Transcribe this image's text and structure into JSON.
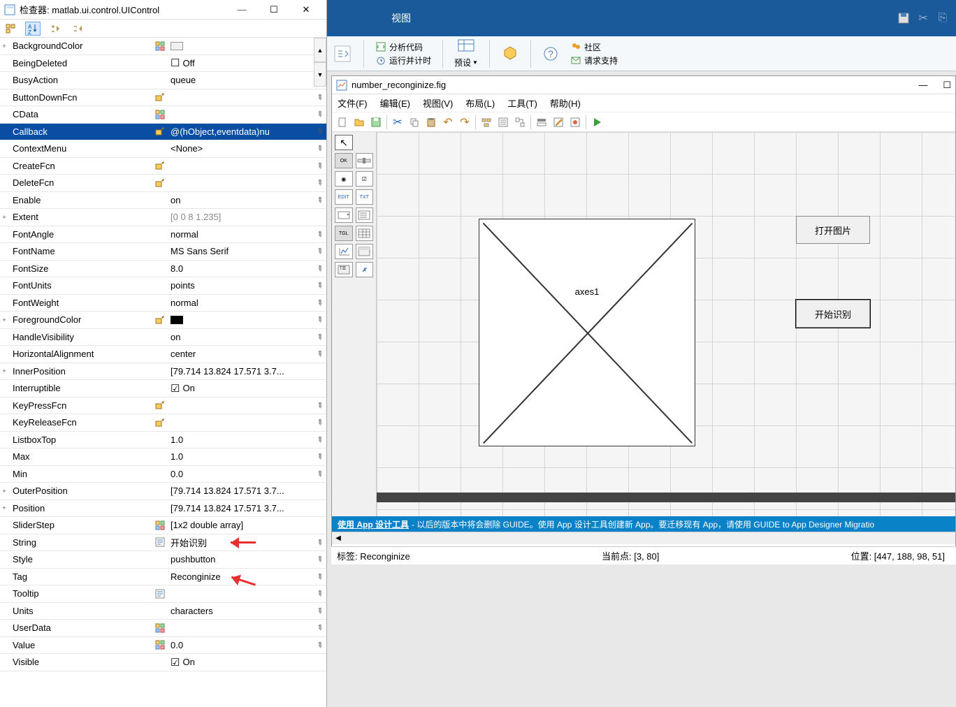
{
  "inspector": {
    "title": "检查器: matlab.ui.control.UIControl",
    "props": [
      {
        "name": "BackgroundColor",
        "icon": "grid",
        "val": "",
        "expand": "+",
        "swatch": "bg",
        "edit": true
      },
      {
        "name": "BeingDeleted",
        "val": "Off",
        "chk": false
      },
      {
        "name": "BusyAction",
        "val": "queue",
        "edit": true
      },
      {
        "name": "ButtonDownFcn",
        "icon": "paint",
        "val": "",
        "edit": true
      },
      {
        "name": "CData",
        "icon": "grid",
        "val": "",
        "edit": true
      },
      {
        "name": "Callback",
        "icon": "paint",
        "val": "@(hObject,eventdata)nu",
        "edit": true,
        "selected": true
      },
      {
        "name": "ContextMenu",
        "val": "<None>",
        "edit": true
      },
      {
        "name": "CreateFcn",
        "icon": "paint",
        "val": "",
        "edit": true
      },
      {
        "name": "DeleteFcn",
        "icon": "paint",
        "val": "",
        "edit": true
      },
      {
        "name": "Enable",
        "val": "on",
        "edit": true
      },
      {
        "name": "Extent",
        "val": "[0 0 8 1.235]",
        "expand": "+",
        "gray": true
      },
      {
        "name": "FontAngle",
        "val": "normal",
        "edit": true
      },
      {
        "name": "FontName",
        "val": "MS Sans Serif",
        "edit": true
      },
      {
        "name": "FontSize",
        "val": "8.0",
        "edit": true
      },
      {
        "name": "FontUnits",
        "val": "points",
        "edit": true
      },
      {
        "name": "FontWeight",
        "val": "normal",
        "edit": true
      },
      {
        "name": "ForegroundColor",
        "icon": "paintc",
        "val": "",
        "expand": "+",
        "swatch": "fg",
        "edit": true
      },
      {
        "name": "HandleVisibility",
        "val": "on",
        "edit": true
      },
      {
        "name": "HorizontalAlignment",
        "val": "center",
        "edit": true
      },
      {
        "name": "InnerPosition",
        "val": "[79.714 13.824 17.571 3.7...",
        "expand": "+"
      },
      {
        "name": "Interruptible",
        "val": "On",
        "chk": true
      },
      {
        "name": "KeyPressFcn",
        "icon": "paint",
        "val": "",
        "edit": true
      },
      {
        "name": "KeyReleaseFcn",
        "icon": "paint",
        "val": "",
        "edit": true
      },
      {
        "name": "ListboxTop",
        "val": "1.0",
        "edit": true
      },
      {
        "name": "Max",
        "val": "1.0",
        "edit": true
      },
      {
        "name": "Min",
        "val": "0.0",
        "edit": true
      },
      {
        "name": "OuterPosition",
        "val": "[79.714 13.824 17.571 3.7...",
        "expand": "+"
      },
      {
        "name": "Position",
        "val": "[79.714 13.824 17.571 3.7...",
        "expand": "+"
      },
      {
        "name": "SliderStep",
        "icon": "grid",
        "val": "[1x2  double array]"
      },
      {
        "name": "String",
        "icon": "lines",
        "val": "开始识别",
        "edit": true,
        "arrow": true
      },
      {
        "name": "Style",
        "val": "pushbutton",
        "edit": true
      },
      {
        "name": "Tag",
        "val": "Reconginize",
        "edit": true,
        "arrow": true
      },
      {
        "name": "Tooltip",
        "icon": "lines",
        "val": "",
        "edit": true
      },
      {
        "name": "Units",
        "val": "characters",
        "edit": true
      },
      {
        "name": "UserData",
        "icon": "grid",
        "val": "",
        "edit": true
      },
      {
        "name": "Value",
        "icon": "grid",
        "val": "0.0",
        "edit": true
      },
      {
        "name": "Visible",
        "val": "On",
        "chk": true
      }
    ]
  },
  "ribbon": {
    "tab_view": "视图",
    "analyze": "分析代码",
    "runtimer": "运行并计时",
    "preset": "预设",
    "community": "社区",
    "support": "请求支持"
  },
  "guide": {
    "title": "number_reconginize.fig",
    "menus": [
      "文件(F)",
      "编辑(E)",
      "视图(V)",
      "布局(L)",
      "工具(T)",
      "帮助(H)"
    ],
    "axes_label": "axes1",
    "btn_open": "打开图片",
    "btn_recognize": "开始识别",
    "bluemsg_bold": "使用 App 设计工具",
    "bluemsg_rest": " - 以后的版本中将会删除 GUIDE。使用 App 设计工具创建新 App。要迁移现有 App，请使用 GUIDE to App Designer Migratio"
  },
  "status": {
    "tag_label": "标签: ",
    "tag_value": "Reconginize",
    "point_label": "当前点: ",
    "point_value": "[3, 80]",
    "pos_label": "位置: ",
    "pos_value": "[447, 188, 98, 51]"
  }
}
